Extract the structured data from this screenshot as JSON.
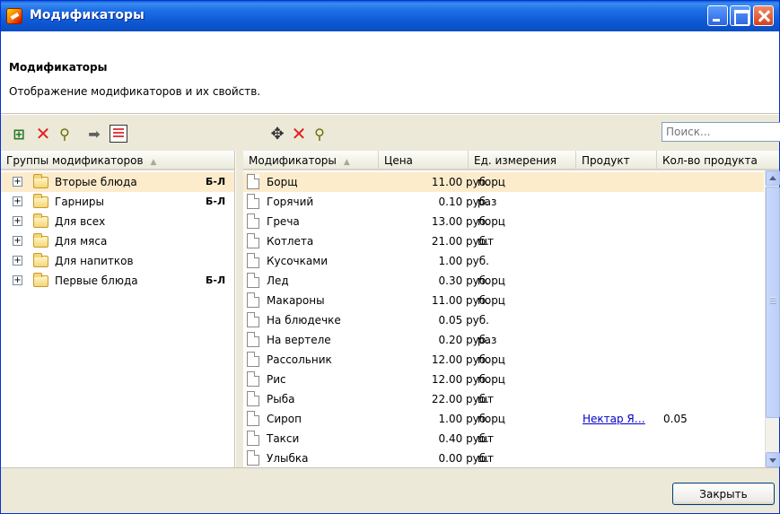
{
  "window": {
    "title": "Модификаторы"
  },
  "header": {
    "title": "Модификаторы",
    "description": "Отображение модификаторов и их свойств."
  },
  "search": {
    "placeholder": "Поиск..."
  },
  "left_panel": {
    "column_header": "Группы модификаторов",
    "items": [
      {
        "label": "Вторые блюда",
        "badge": "Б-Л",
        "selected": true
      },
      {
        "label": "Гарниры",
        "badge": "Б-Л"
      },
      {
        "label": "Для всех",
        "badge": ""
      },
      {
        "label": "Для мяса",
        "badge": ""
      },
      {
        "label": "Для напитков",
        "badge": ""
      },
      {
        "label": "Первые блюда",
        "badge": "Б-Л"
      }
    ]
  },
  "right_panel": {
    "columns": [
      "Модификаторы",
      "Цена",
      "Ед. измерения",
      "Продукт",
      "Кол-во продукта"
    ],
    "rows": [
      {
        "name": "Борщ",
        "price": "11.00 руб.",
        "unit": "порц",
        "product": "",
        "qty": "",
        "selected": true
      },
      {
        "name": "Горячий",
        "price": "0.10 руб.",
        "unit": "раз",
        "product": "",
        "qty": ""
      },
      {
        "name": "Греча",
        "price": "13.00 руб.",
        "unit": "порц",
        "product": "",
        "qty": ""
      },
      {
        "name": "Котлета",
        "price": "21.00 руб.",
        "unit": "шт",
        "product": "",
        "qty": ""
      },
      {
        "name": "Кусочками",
        "price": "1.00 руб.",
        "unit": "",
        "product": "",
        "qty": ""
      },
      {
        "name": "Лед",
        "price": "0.30 руб.",
        "unit": "порц",
        "product": "",
        "qty": ""
      },
      {
        "name": "Макароны",
        "price": "11.00 руб.",
        "unit": "порц",
        "product": "",
        "qty": ""
      },
      {
        "name": "На блюдечке",
        "price": "0.05 руб.",
        "unit": "",
        "product": "",
        "qty": ""
      },
      {
        "name": "На вертеле",
        "price": "0.20 руб.",
        "unit": "раз",
        "product": "",
        "qty": ""
      },
      {
        "name": "Рассольник",
        "price": "12.00 руб.",
        "unit": "порц",
        "product": "",
        "qty": ""
      },
      {
        "name": "Рис",
        "price": "12.00 руб.",
        "unit": "порц",
        "product": "",
        "qty": ""
      },
      {
        "name": "Рыба",
        "price": "22.00 руб.",
        "unit": "шт",
        "product": "",
        "qty": ""
      },
      {
        "name": "Сироп",
        "price": "1.00 руб.",
        "unit": "порц",
        "product": "Нектар Я…",
        "qty": "0.05"
      },
      {
        "name": "Такси",
        "price": "0.40 руб.",
        "unit": "шт",
        "product": "",
        "qty": ""
      },
      {
        "name": "Улыбка",
        "price": "0.00 руб.",
        "unit": "шт",
        "product": "",
        "qty": ""
      }
    ]
  },
  "footer": {
    "close_label": "Закрыть"
  },
  "icons": {
    "tree_add": "add-group-icon",
    "delete": "delete-icon",
    "find": "find-icon",
    "move": "arrow-right-icon",
    "properties": "properties-icon",
    "add": "add-icon"
  },
  "colors": {
    "titlebar": "#0d58d4",
    "selection": "#fceccc",
    "panel_bg": "#ece9d8",
    "link": "#0000cc"
  }
}
